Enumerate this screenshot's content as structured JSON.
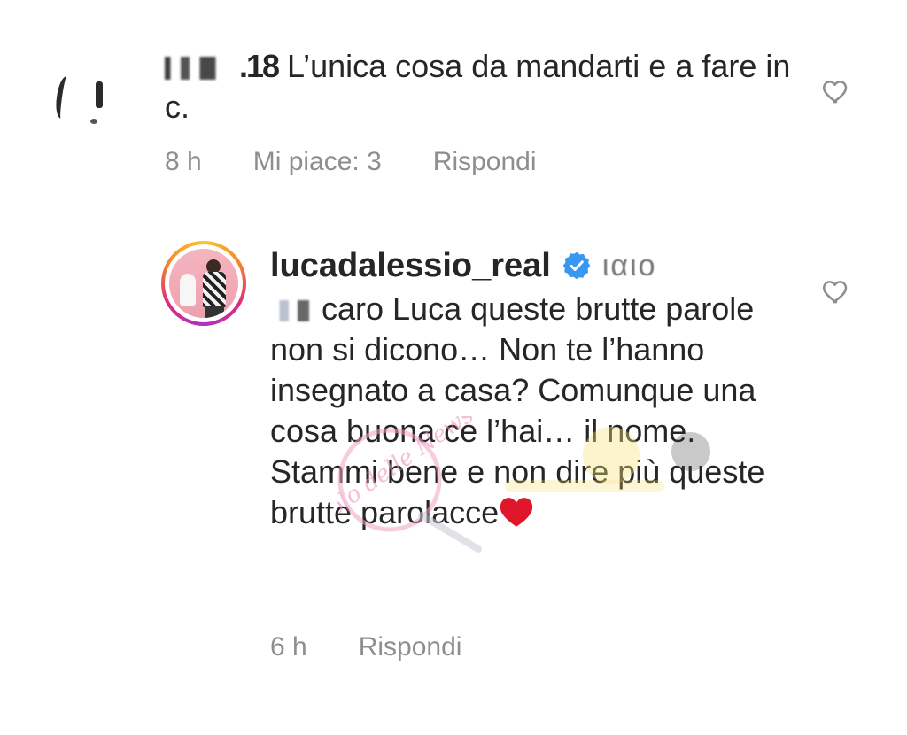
{
  "comment1": {
    "username_partial": ".18",
    "text": " L’unica cosa da mandarti e a fare in c.",
    "time": "8 h",
    "likes": "Mi piace: 3",
    "reply": "Rispondi"
  },
  "comment2": {
    "username": "lucadalessio_real",
    "handle_partial": "ιαιο",
    "text": "caro Luca queste brutte parole non si dicono… Non te l’hanno insegnato a casa? Comunque una cosa buona ce l’hai… il nome. Stammi bene e non dire più queste brutte parolacce",
    "time": "6 h",
    "reply": "Rispondi"
  },
  "watermark_text": "Vicolo delle News",
  "colors": {
    "text": "#262626",
    "meta": "#8e8e8e",
    "verified": "#3897f0",
    "heart_emoji": "#e0162b"
  },
  "icons": {
    "like": "heart-outline-icon",
    "verified": "verified-badge-icon",
    "emoji": "red-heart-emoji"
  }
}
